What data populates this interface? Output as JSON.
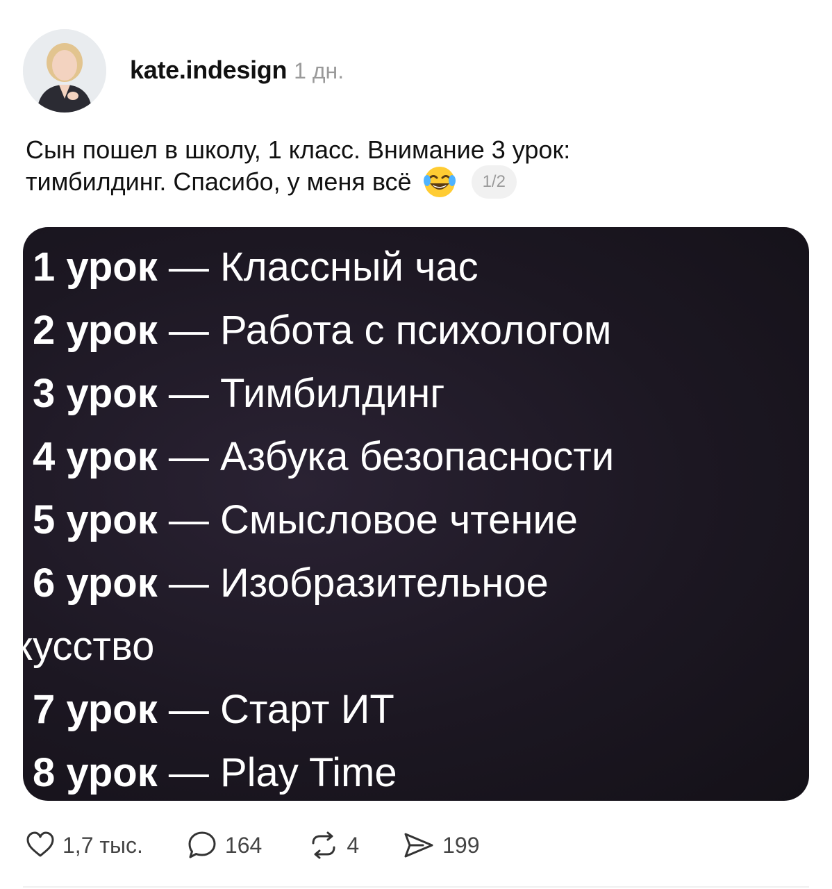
{
  "post": {
    "avatar_icon": "user-avatar-photo",
    "username": "kate.indesign",
    "time": "1 дн.",
    "text_line1": "Сын пошел в школу, 1 класс. Внимание 3 урок:",
    "text_line2": "тимбилдинг. Спасибо, у меня всё",
    "emoji": "face-with-tears-of-joy-emoji",
    "media_counter": "1/2"
  },
  "media": {
    "lessons": [
      {
        "num": "1 урок",
        "dash": " — ",
        "subject": "Классный час"
      },
      {
        "num": "2 урок",
        "dash": " — ",
        "subject": "Работа с психологом"
      },
      {
        "num": "3 урок",
        "dash": " — ",
        "subject": "Тимбилдинг"
      },
      {
        "num": "4 урок",
        "dash": " — ",
        "subject": "Азбука безопасности"
      },
      {
        "num": "5 урок",
        "dash": " — ",
        "subject": "Смысловое чтение"
      },
      {
        "num": "6 урок",
        "dash": " — ",
        "subject": "Изобразительное"
      },
      {
        "num": "",
        "dash": "",
        "subject": "кусство"
      },
      {
        "num": "7 урок",
        "dash": " — ",
        "subject": "Старт ИТ"
      },
      {
        "num": "8 урок",
        "dash": " — ",
        "subject": "Play Time"
      }
    ]
  },
  "actions": {
    "like": {
      "icon": "heart-icon",
      "count": "1,7 тыс."
    },
    "comment": {
      "icon": "comment-bubble-icon",
      "count": "164"
    },
    "repost": {
      "icon": "repost-icon",
      "count": "4"
    },
    "share": {
      "icon": "send-icon",
      "count": "199"
    }
  },
  "colors": {
    "text": "#111111",
    "muted": "#9a9a9a",
    "card_bg": "#1c1722"
  }
}
